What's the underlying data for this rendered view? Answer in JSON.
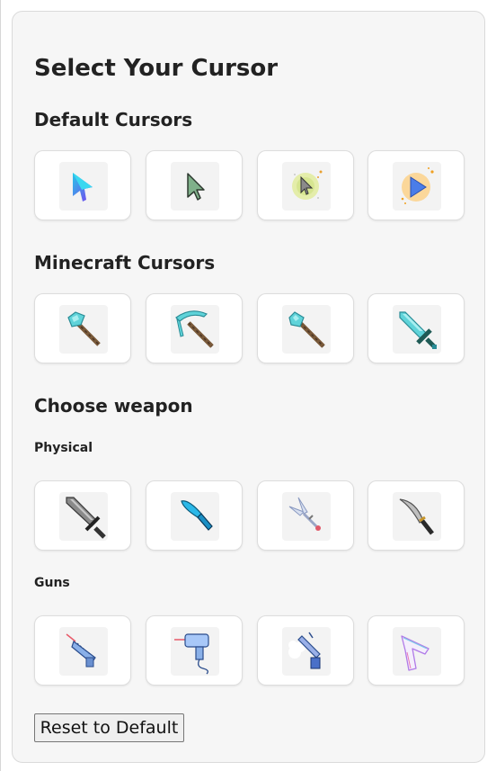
{
  "title": "Select Your Cursor",
  "sections": {
    "default": {
      "heading": "Default Cursors"
    },
    "minecraft": {
      "heading": "Minecraft Cursors"
    },
    "weapon": {
      "heading": "Choose weapon",
      "physical_label": "Physical",
      "guns_label": "Guns"
    }
  },
  "cursors": {
    "default": [
      "cyan-gradient-arrow-icon",
      "green-arrow-icon",
      "sparkle-arrow-icon",
      "blue-arrow-yellow-glow-icon"
    ],
    "minecraft": [
      "diamond-axe-icon",
      "diamond-pickaxe-icon",
      "diamond-shovel-icon",
      "diamond-sword-icon"
    ],
    "physical": [
      "broadsword-icon",
      "blue-knife-icon",
      "kunai-icon",
      "machete-icon"
    ],
    "guns": [
      "laser-blaster-icon",
      "drill-gun-icon",
      "smoke-pistol-icon",
      "neon-pistol-icon"
    ]
  },
  "colors": {
    "panel_bg": "#f6f6f6",
    "card_bg": "#ffffff",
    "diamond": "#5fd3d9",
    "stick": "#7a5a3a"
  },
  "reset_label": "Reset to Default"
}
